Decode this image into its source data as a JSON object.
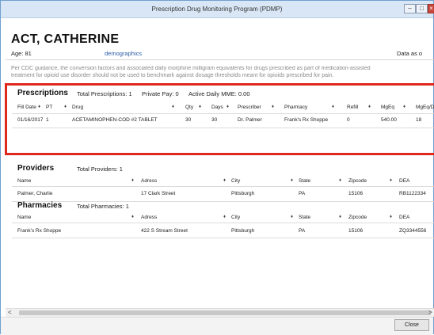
{
  "window": {
    "title": "Prescription Drug Monitoring Program (PDMP)",
    "min_icon": "minimize-icon",
    "max_icon": "maximize-icon",
    "close_icon": "close-icon"
  },
  "patient": {
    "name": "ACT, CATHERINE",
    "age": "Age: 81",
    "demographics_link": "demographics",
    "data_as_of": "Data as o"
  },
  "notice": {
    "line1": "Per CDC guidance, the conversion factors and associated daily morphine milligram equivalents for drugs prescribed as part of medication-assisted",
    "line2": "treatment for opioid use disorder should not be used to benchmark against dosage thresholds meant for opioids prescribed for pain."
  },
  "prescriptions": {
    "title": "Prescriptions",
    "total": "Total Prescriptions: 1",
    "private_pay": "Private Pay: 0",
    "mme": "Active Daily MME: 0.00",
    "columns": [
      "Fill Date",
      "PT",
      "Drug",
      "Qty",
      "Days",
      "Prescriber",
      "Pharmacy",
      "Refill",
      "MgEq",
      "MgEq/D"
    ],
    "rows": [
      [
        "01/16/2017",
        "1",
        "ACETAMINOPHEN-COD #2 TABLET",
        "30",
        "30",
        "Dr. Palmer",
        "Frank's Rx Shoppe",
        "0",
        "540.00",
        "18"
      ]
    ]
  },
  "providers": {
    "title": "Providers",
    "total": "Total Providers: 1",
    "columns": [
      "Name",
      "Adress",
      "City",
      "State",
      "Zipcode",
      "DEA"
    ],
    "rows": [
      [
        "Palmer, Charlie",
        "17 Clark Street",
        "Pittsburgh",
        "PA",
        "15106",
        "RB1122334"
      ]
    ]
  },
  "pharmacies": {
    "title": "Pharmacies",
    "total": "Total Pharmacies: 1",
    "columns": [
      "Name",
      "Adress",
      "City",
      "State",
      "Zipcode",
      "DEA"
    ],
    "rows": [
      [
        "Frank's Rx Shoppe",
        "422 S Stream Street",
        "Pittsburgh",
        "PA",
        "15106",
        "ZQ3344556"
      ]
    ]
  },
  "footer": {
    "close_label": "Close"
  },
  "scroll": {
    "left_arrow": "<",
    "right_arrow": ">"
  },
  "sort_glyph": "♦",
  "highlight_color": "#e0271d"
}
